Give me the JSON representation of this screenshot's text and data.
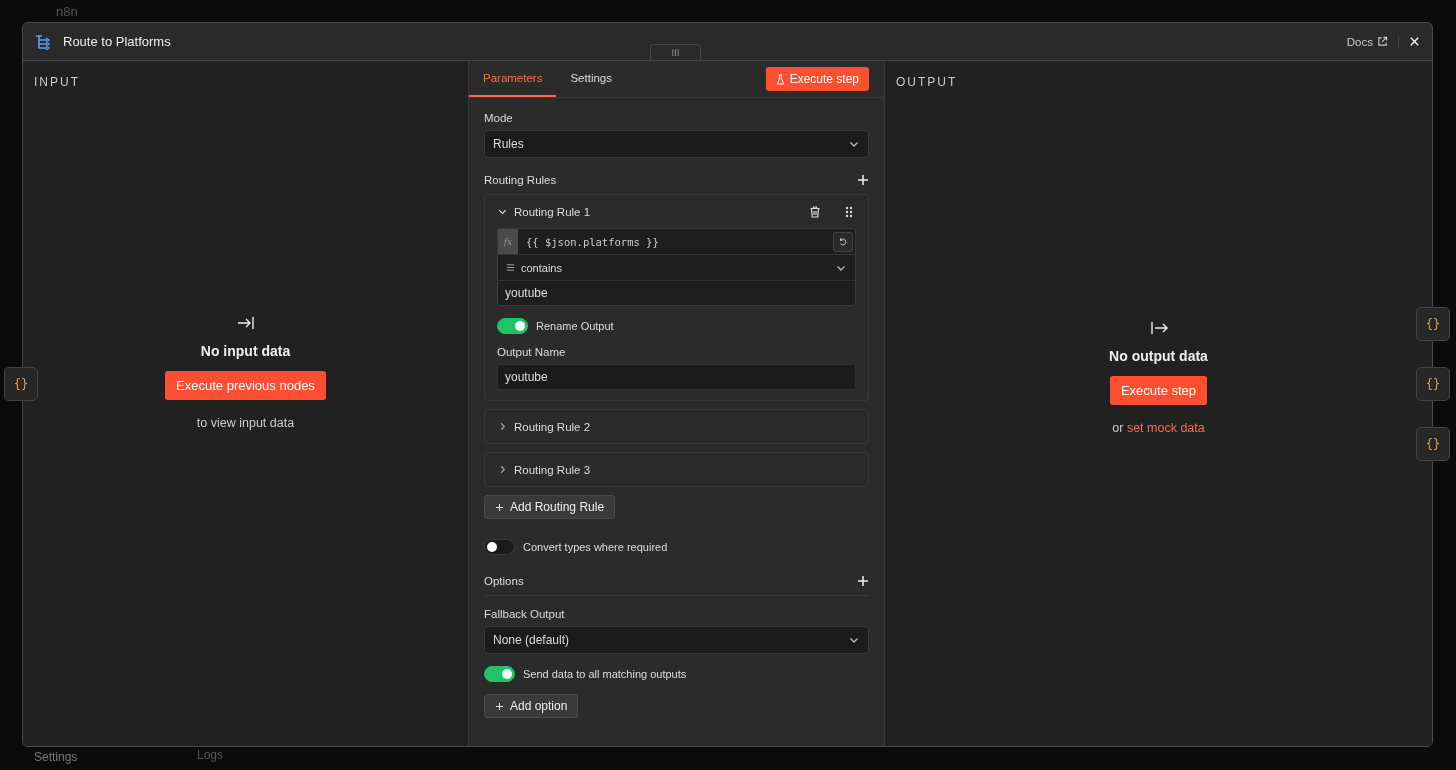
{
  "background": {
    "app_name": "n8n",
    "sidebar_item": "Settings",
    "bottom_bar": "Logs"
  },
  "modal": {
    "title": "Route to Platforms",
    "docs_link": "Docs"
  },
  "input": {
    "heading": "INPUT",
    "message": "No input data",
    "button": "Execute previous nodes",
    "hint": "to view input data"
  },
  "tabs": [
    {
      "label": "Parameters",
      "selected": true
    },
    {
      "label": "Settings",
      "selected": false
    }
  ],
  "execute_button": "Execute step",
  "mode": {
    "label": "Mode",
    "value": "Rules"
  },
  "routing_rules": {
    "label": "Routing Rules",
    "add_button": "Add Routing Rule",
    "rules": [
      {
        "title": "Routing Rule 1",
        "expanded": true,
        "expression_prefix": "fx",
        "expression": "{{ $json.platforms }}",
        "operator": "contains",
        "value": "youtube",
        "rename_output": {
          "label": "Rename Output",
          "on": true
        },
        "output_name": {
          "label": "Output Name",
          "value": "youtube"
        }
      },
      {
        "title": "Routing Rule 2",
        "expanded": false
      },
      {
        "title": "Routing Rule 3",
        "expanded": false
      }
    ]
  },
  "convert_types": {
    "label": "Convert types where required",
    "on": false
  },
  "options": {
    "label": "Options",
    "fallback": {
      "label": "Fallback Output",
      "value": "None (default)"
    },
    "send_all": {
      "label": "Send data to all matching outputs",
      "on": true
    },
    "add_button": "Add option"
  },
  "output": {
    "heading": "OUTPUT",
    "message": "No output data",
    "button": "Execute step",
    "hint_prefix": "or",
    "hint_link": "set mock data"
  },
  "node_buttons": {
    "input": [
      "{}"
    ],
    "output": [
      "{}",
      "{}",
      "{}"
    ]
  }
}
